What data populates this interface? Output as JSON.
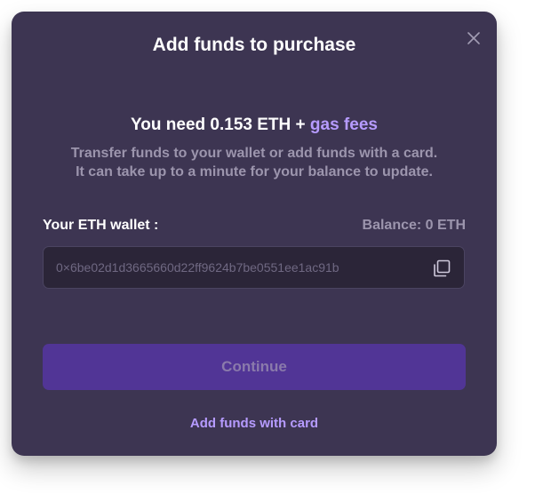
{
  "modal": {
    "title": "Add funds to purchase",
    "close_icon": "close-icon"
  },
  "requirement": {
    "prefix": "You need 0.153 ETH + ",
    "gas_fees_link": "gas fees"
  },
  "description": {
    "line1": "Transfer funds to your wallet or add funds with a card.",
    "line2": "It can take up to a minute for your balance to update."
  },
  "wallet": {
    "label": "Your ETH wallet :",
    "balance": "Balance: 0 ETH",
    "address": "0×6be02d1d3665660d22ff9624b7be0551ee1ac91b",
    "copy_icon": "copy-icon"
  },
  "actions": {
    "continue_label": "Continue",
    "add_funds_card_label": "Add funds with card"
  },
  "colors": {
    "modal_bg": "#3d3552",
    "accent": "#b69bff",
    "button_bg": "#513596",
    "muted_text": "#9c95ad"
  }
}
